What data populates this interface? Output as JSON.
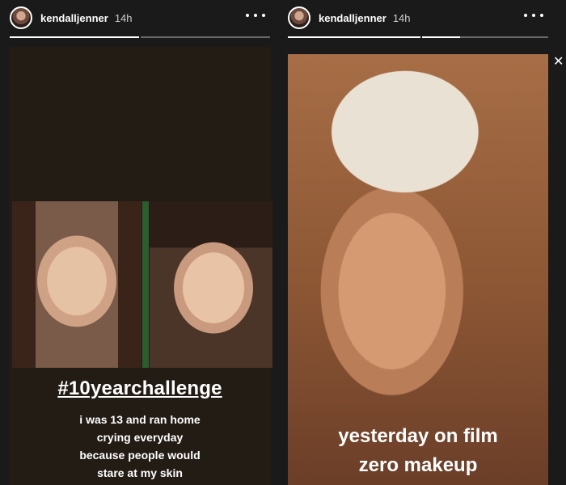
{
  "left_story": {
    "username": "kendalljenner",
    "time": "14h",
    "hashtag": "#10yearchallenge",
    "caption_lines": [
      "i was 13 and ran home",
      "crying everyday",
      "because people would",
      "stare at my skin"
    ],
    "progress_segments": [
      1,
      0
    ]
  },
  "right_story": {
    "username": "kendalljenner",
    "time": "14h",
    "caption_lines": [
      "yesterday on film",
      "zero makeup"
    ],
    "progress_segments": [
      1,
      0.3
    ]
  },
  "icons": {
    "more": "more-options-icon",
    "close": "close-icon",
    "close_glyph": "✕"
  },
  "colors": {
    "green_divider": "#2a5e2c"
  }
}
